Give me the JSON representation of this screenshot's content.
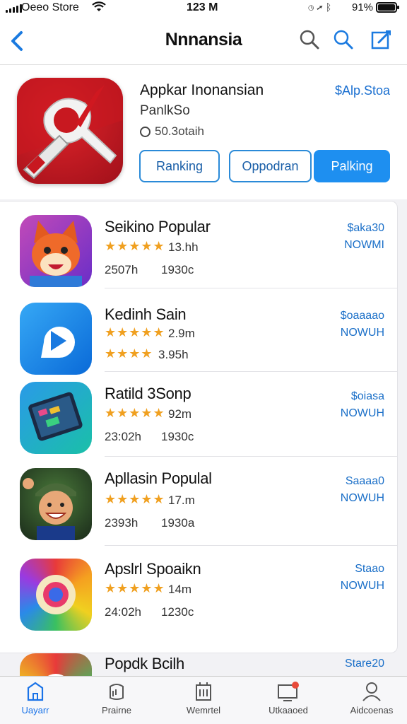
{
  "status_bar": {
    "carrier": "Oeeo Store",
    "time": "123 M",
    "battery": "91%",
    "icons": [
      "signal-icon",
      "wifi-icon",
      "alarm-icon",
      "location-icon",
      "bluetooth-icon",
      "battery-icon"
    ]
  },
  "nav": {
    "title": "Nnnansia",
    "back_icon": "chevron-left-icon",
    "actions": [
      "search-icon",
      "search-icon",
      "compose-icon"
    ]
  },
  "featured": {
    "name": "Appkar Inonansian",
    "subtitle": "PanlkSo",
    "size": "50.3otaih",
    "price": "$Alp.Stoa",
    "buttons": [
      {
        "label": "Ranking",
        "style": "outline"
      },
      {
        "label": "Oppodran",
        "style": "outline"
      },
      {
        "label": "Palking",
        "style": "filled"
      }
    ]
  },
  "apps": [
    {
      "name": "Seikino Popular",
      "rating": "13.hh",
      "meta_left": "2507h",
      "meta_right": "1930c",
      "price": "$aka30",
      "action": "NOWMI",
      "icon": "fox-app-icon",
      "stars": 5
    },
    {
      "name": "Kedinh Sain",
      "rating": "2.9m",
      "meta_left": "",
      "meta_right": "3.95h",
      "price": "$oaaaao",
      "action": "NOWUH",
      "icon": "play-app-icon",
      "stars": 5,
      "stars2": 4
    },
    {
      "name": "Ratild 3Sonp",
      "rating": "92m",
      "meta_left": "23:02h",
      "meta_right": "1930c",
      "price": "$oiasa",
      "action": "NOWUH",
      "icon": "tablet-app-icon",
      "stars": 5
    },
    {
      "name": "Apllasin Populal",
      "rating": "17.m",
      "meta_left": "2393h",
      "meta_right": "1930a",
      "price": "Saaaa0",
      "action": "NOWUH",
      "icon": "boy-app-icon",
      "stars": 5
    },
    {
      "name": "Apslrl Spoaikn",
      "rating": "14m",
      "meta_left": "24:02h",
      "meta_right": "1230c",
      "price": "Staao",
      "action": "NOWUH",
      "icon": "colorful-app-icon",
      "stars": 5
    },
    {
      "name": "Popdk Bcilh",
      "rating": "",
      "meta_left": "",
      "meta_right": "",
      "price": "Stare20",
      "action": "",
      "icon": "green-app-icon",
      "stars": 0
    }
  ],
  "tabs": [
    {
      "label": "Uayarr",
      "icon": "today-icon",
      "active": true
    },
    {
      "label": "Prairne",
      "icon": "games-icon",
      "active": false
    },
    {
      "label": "Wemrtel",
      "icon": "apps-icon",
      "active": false
    },
    {
      "label": "Utkaaoed",
      "icon": "updates-icon",
      "active": false
    },
    {
      "label": "Aidcoenas",
      "icon": "account-icon",
      "active": false
    }
  ],
  "colors": {
    "accent": "#1e8ff0",
    "star": "#f0a020",
    "link": "#1a6fc8",
    "icon_red": "#c8141c"
  }
}
